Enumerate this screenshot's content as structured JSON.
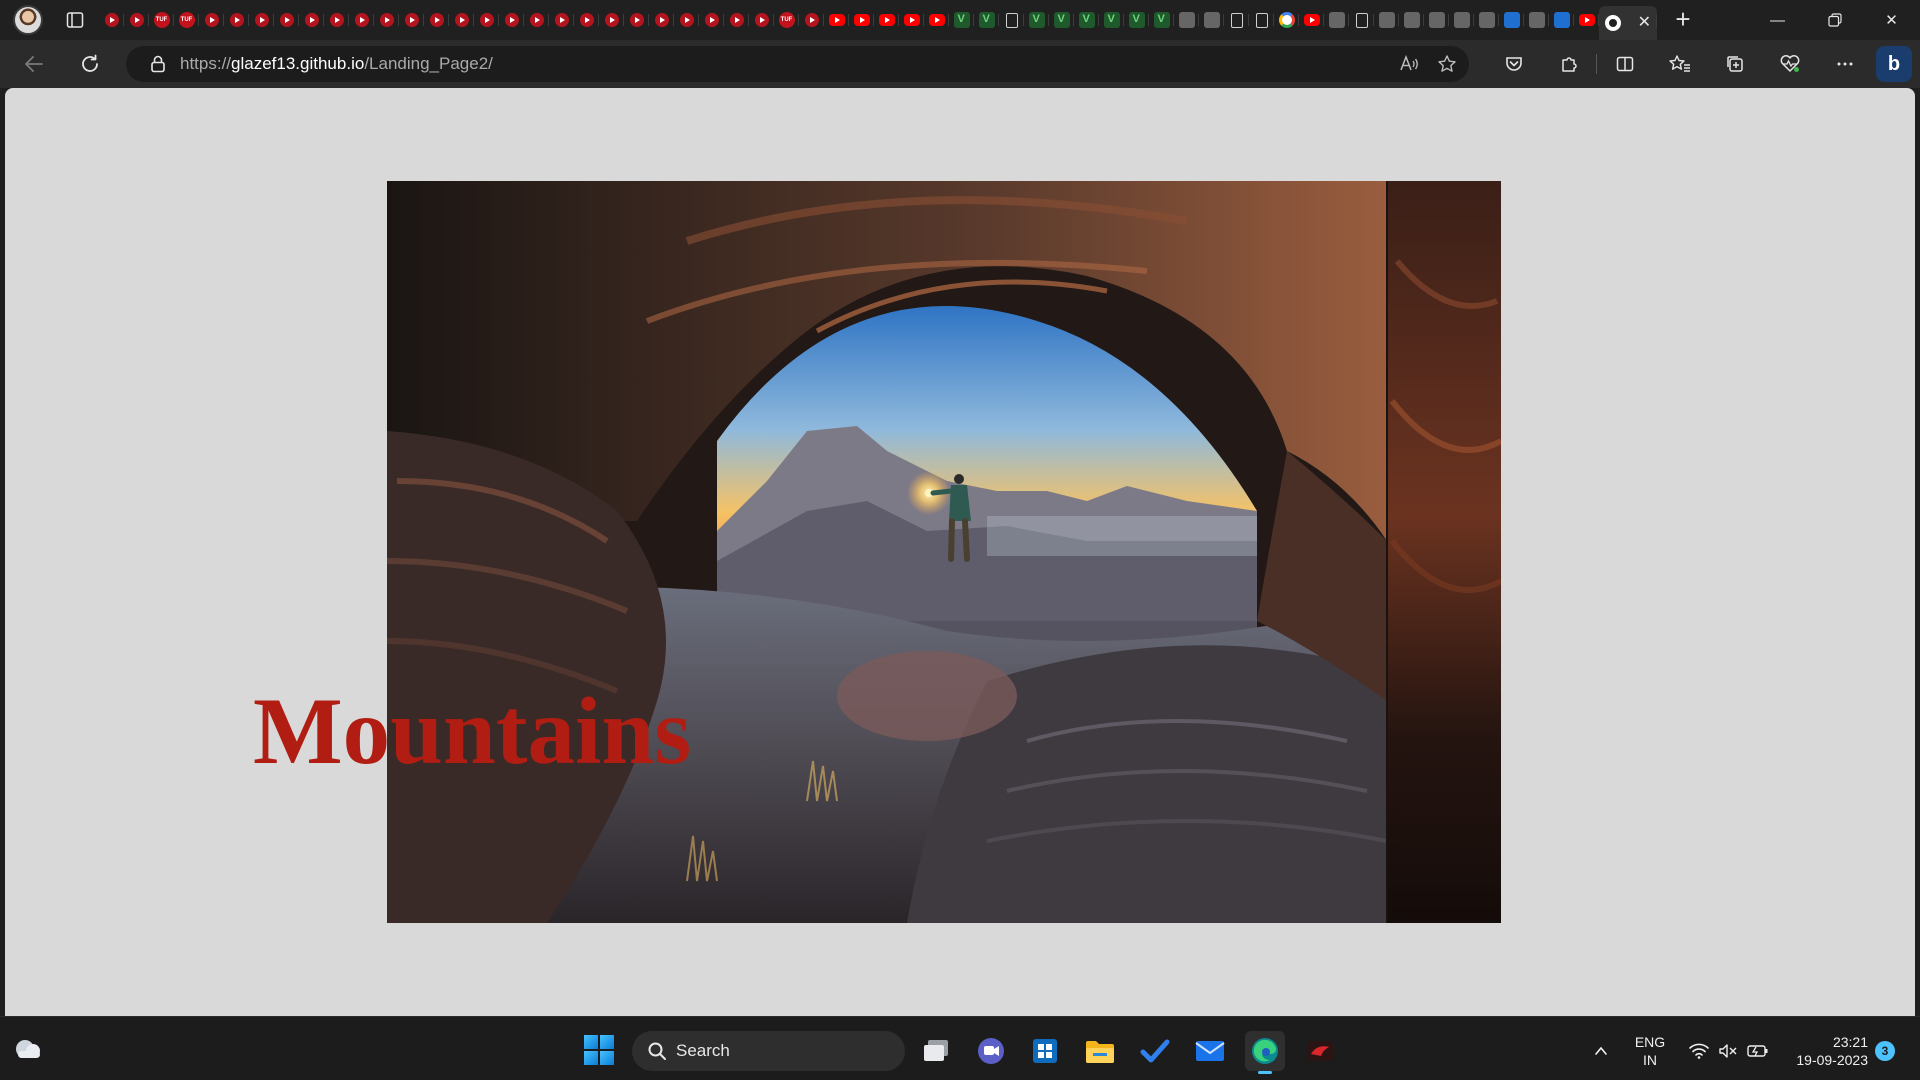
{
  "browser": {
    "tab_favicons": [
      "red-play",
      "red-play",
      "tuf",
      "tuf",
      "red-play",
      "red-play",
      "red-play",
      "red-play",
      "red-play",
      "red-play",
      "red-play",
      "red-play",
      "red-play",
      "red-play",
      "red-play",
      "red-play",
      "red-play",
      "red-play",
      "red-play",
      "red-play",
      "red-play",
      "red-play",
      "red-play",
      "red-play",
      "red-play",
      "red-play",
      "red-play",
      "tuf",
      "red-play",
      "youtube",
      "youtube",
      "youtube",
      "youtube",
      "youtube",
      "green",
      "green",
      "doc",
      "green",
      "green",
      "green",
      "green",
      "green",
      "green",
      "misc",
      "misc",
      "doc",
      "doc",
      "google",
      "youtube",
      "misc",
      "doc",
      "misc",
      "misc",
      "misc",
      "misc",
      "misc",
      "blue",
      "misc",
      "blue",
      "youtube"
    ],
    "active_tab_favicon": "github",
    "address": {
      "scheme": "https://",
      "host": "glazef13.github.io",
      "path": "/Landing_Page2/"
    }
  },
  "page": {
    "hero_title": "Mountains",
    "hero_image_alt": "Hiker with lantern under a rock arch at sunset",
    "background_color": "#d9d9d9",
    "title_color": "#b11d12"
  },
  "taskbar": {
    "search_label": "Search",
    "lang_line1": "ENG",
    "lang_line2": "IN",
    "time": "23:21",
    "date": "19-09-2023",
    "notification_count": "3"
  }
}
